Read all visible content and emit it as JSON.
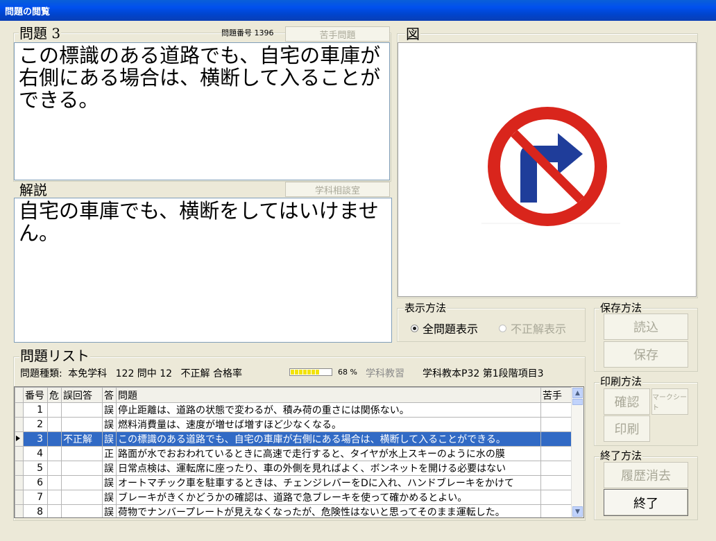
{
  "window": {
    "title": "問題の閲覧"
  },
  "question": {
    "group_label": "問題 3",
    "number_label": "問題番号 1396",
    "weak_button": "苦手問題",
    "text": "この標識のある道路でも、自宅の車庫が右側にある場合は、横断して入ることができる。"
  },
  "explanation": {
    "group_label": "解説",
    "consult_button": "学科相談室",
    "text": "自宅の車庫でも、横断をしてはいけません。"
  },
  "figure": {
    "group_label": "図",
    "icon": "no-right-turn-sign-icon"
  },
  "display_mode": {
    "group_label": "表示方法",
    "options": [
      {
        "label": "全問題表示",
        "selected": true,
        "enabled": true
      },
      {
        "label": "不正解表示",
        "selected": false,
        "enabled": false
      }
    ]
  },
  "save": {
    "group_label": "保存方法",
    "load_button": "読込",
    "save_button": "保存"
  },
  "print": {
    "group_label": "印刷方法",
    "confirm_button": "確認",
    "marksheet_button": "マークシート",
    "print_button": "印刷"
  },
  "exit": {
    "group_label": "終了方法",
    "clear_history_button": "履歴消去",
    "exit_button": "終了"
  },
  "question_list": {
    "group_label": "問題リスト",
    "type_label": "問題種類:",
    "type_value": "本免学科",
    "count_text": "122 問中 12",
    "incorrect_label": "不正解",
    "pass_rate_label": "合格率",
    "pass_rate_percent": "68 %",
    "pass_rate_value": 0.68,
    "study_label": "学科教習",
    "textbook_ref": "学科教本P32 第1段階項目3",
    "columns": [
      "番号",
      "危",
      "誤回答",
      "答",
      "問題",
      "苦手"
    ],
    "rows": [
      {
        "no": "1",
        "danger": "",
        "wrong": "",
        "answer": "誤",
        "question": "停止距離は、道路の状態で変わるが、積み荷の重さには関係ない。",
        "weak": "",
        "selected": false
      },
      {
        "no": "2",
        "danger": "",
        "wrong": "",
        "answer": "誤",
        "question": "燃料消費量は、速度が増せば増すほど少なくなる。",
        "weak": "",
        "selected": false
      },
      {
        "no": "3",
        "danger": "",
        "wrong": "不正解",
        "answer": "誤",
        "question": "この標識のある道路でも、自宅の車庫が右側にある場合は、横断して入ることができる。",
        "weak": "",
        "selected": true
      },
      {
        "no": "4",
        "danger": "",
        "wrong": "",
        "answer": "正",
        "question": "路面が水でおおわれているときに高速で走行すると、タイヤが水上スキーのように水の膜",
        "weak": "",
        "selected": false
      },
      {
        "no": "5",
        "danger": "",
        "wrong": "",
        "answer": "誤",
        "question": "日常点検は、運転席に座ったり、車の外側を見ればよく、ボンネットを開ける必要はない",
        "weak": "",
        "selected": false
      },
      {
        "no": "6",
        "danger": "",
        "wrong": "",
        "answer": "誤",
        "question": "オートマチック車を駐車するときは、チェンジレバーをDに入れ、ハンドブレーキをかけて",
        "weak": "",
        "selected": false
      },
      {
        "no": "7",
        "danger": "",
        "wrong": "",
        "answer": "誤",
        "question": "ブレーキがきくかどうかの確認は、道路で急ブレーキを使って確かめるとよい。",
        "weak": "",
        "selected": false
      },
      {
        "no": "8",
        "danger": "",
        "wrong": "",
        "answer": "誤",
        "question": "荷物でナンバープレートが見えなくなったが、危険性はないと思ってそのまま運転した。",
        "weak": "",
        "selected": false
      }
    ]
  }
}
